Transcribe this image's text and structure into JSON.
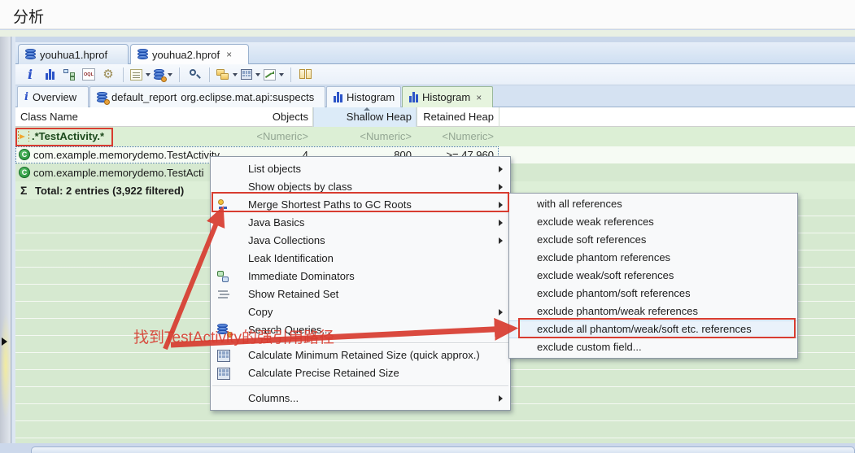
{
  "window": {
    "title": "分析"
  },
  "editor_tabs": [
    {
      "label": "youhua1.hprof",
      "active": false
    },
    {
      "label": "youhua2.hprof",
      "active": true,
      "close_glyph": "×"
    }
  ],
  "toolbar": {
    "info_glyph": "i",
    "oql_glyph": "OQL",
    "gear_glyph": "⚙",
    "buttons": [
      "info",
      "histogram",
      "dominator-tree",
      "oql",
      "customize-expert",
      "query-list",
      "search-queries",
      "find",
      "group-by",
      "calculator",
      "percentage-view",
      "compare-columns"
    ]
  },
  "view_tabs": [
    {
      "label": "Overview",
      "icon": "info"
    },
    {
      "label": "default_report",
      "sublabel": "org.eclipse.mat.api:suspects",
      "icon": "report-db"
    },
    {
      "label": "Histogram",
      "icon": "histogram"
    },
    {
      "label": "Histogram",
      "icon": "histogram",
      "active": true,
      "close_glyph": "×"
    }
  ],
  "table": {
    "columns": {
      "c0": "Class Name",
      "c1": "Objects",
      "c2": "Shallow Heap",
      "c3": "Retained Heap"
    },
    "filter_row": {
      "pattern": ".*TestActivity.*",
      "numeric1": "<Numeric>",
      "numeric2": "<Numeric>",
      "numeric3": "<Numeric>"
    },
    "rows": [
      {
        "class_glyph": "C",
        "class_name": "com.example.memorydemo.TestActivity",
        "objects": "4",
        "shallow_heap": "800",
        "retained_heap": ">= 47,960"
      },
      {
        "class_glyph": "C",
        "class_name": "com.example.memorydemo.TestActi",
        "objects": "",
        "shallow_heap": "",
        "retained_heap": ""
      }
    ],
    "total_row": {
      "sigma": "Σ",
      "text": "Total: 2 entries (3,922 filtered)"
    }
  },
  "context_menu": {
    "items": [
      {
        "label": "List objects"
      },
      {
        "label": "Show objects by class"
      },
      {
        "label": "Merge Shortest Paths to GC Roots"
      },
      {
        "label": "Java Basics"
      },
      {
        "label": "Java Collections"
      },
      {
        "label": "Leak Identification"
      },
      {
        "label": "Immediate Dominators"
      },
      {
        "label": "Show Retained Set"
      },
      {
        "label": "Copy"
      },
      {
        "label": "Search Queries..."
      },
      {
        "label": "Calculate Minimum Retained Size (quick approx.)"
      },
      {
        "label": "Calculate Precise Retained Size"
      },
      {
        "label": "Columns..."
      }
    ]
  },
  "submenu": {
    "items": [
      {
        "label": "with all references"
      },
      {
        "label": "exclude weak references"
      },
      {
        "label": "exclude soft references"
      },
      {
        "label": "exclude phantom references"
      },
      {
        "label": "exclude weak/soft references"
      },
      {
        "label": "exclude phantom/soft references"
      },
      {
        "label": "exclude phantom/weak references"
      },
      {
        "label": "exclude all phantom/weak/soft etc. references",
        "highlighted": true
      },
      {
        "label": "exclude custom field..."
      }
    ]
  },
  "annotation": {
    "text": "找到TestActivity的强引用路径",
    "color": "#d83c30"
  }
}
